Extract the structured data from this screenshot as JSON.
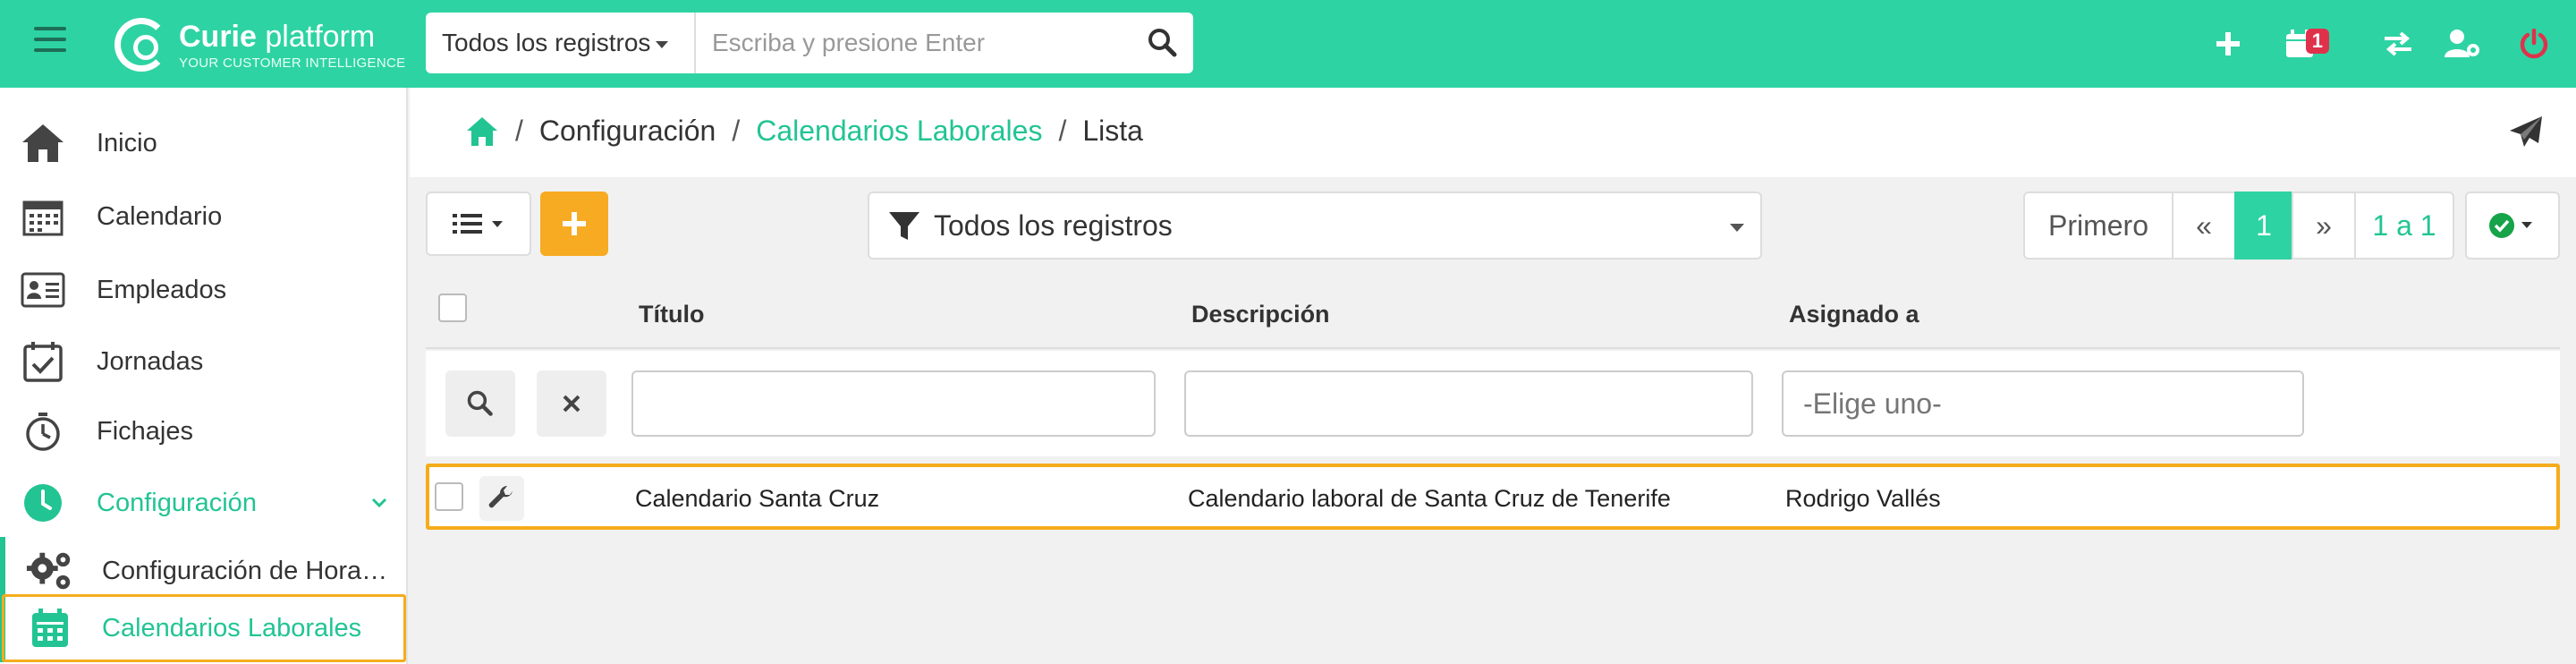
{
  "header": {
    "logo_name_bold": "Curie",
    "logo_name_rest": "platform",
    "logo_tagline": "YOUR CUSTOMER INTELLIGENCE",
    "search_scope": "Todos los registros",
    "search_placeholder": "Escriba y presione Enter",
    "calendar_badge": "1",
    "colors": {
      "brand": "#2ed3a3",
      "badge": "#e0314b",
      "power": "#e0314b"
    }
  },
  "sidebar": {
    "items": [
      {
        "label": "Inicio",
        "icon": "home-icon"
      },
      {
        "label": "Calendario",
        "icon": "calendar-icon"
      },
      {
        "label": "Empleados",
        "icon": "id-card-icon"
      },
      {
        "label": "Jornadas",
        "icon": "calendar-check-icon"
      },
      {
        "label": "Fichajes",
        "icon": "stopwatch-icon"
      },
      {
        "label": "Configuración",
        "icon": "clock-icon"
      },
      {
        "label": "Configuración de Hora…",
        "icon": "gears-icon"
      },
      {
        "label": "Calendarios Laborales",
        "icon": "calendar-alt-icon"
      }
    ]
  },
  "breadcrumb": {
    "level1": "Configuración",
    "level2": "Calendarios Laborales",
    "level3": "Lista",
    "separator": "/"
  },
  "toolbar": {
    "filter_label": "Todos los registros",
    "pager": {
      "first": "Primero",
      "prev": "«",
      "current": "1",
      "next": "»",
      "count": "1 a 1"
    },
    "accent": "#f7ab22"
  },
  "table": {
    "columns": [
      "Título",
      "Descripción",
      "Asignado a"
    ],
    "assigned_placeholder": "-Elige uno-",
    "rows": [
      {
        "title": "Calendario Santa Cruz",
        "description": "Calendario laboral de Santa Cruz de Tenerife",
        "assigned": "Rodrigo Vallés"
      }
    ]
  }
}
